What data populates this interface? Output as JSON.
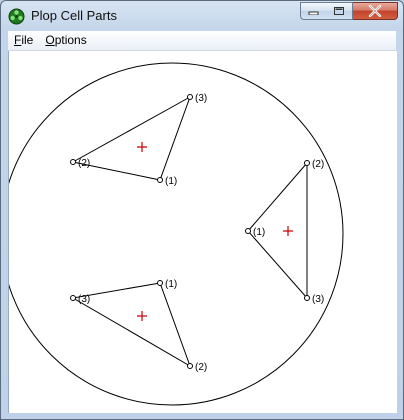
{
  "window": {
    "title": "Plop Cell Parts"
  },
  "menu": {
    "file_label": "File",
    "file_accel": "F",
    "file_rest": "ile",
    "options_label": "Options",
    "options_accel": "O",
    "options_rest": "ptions"
  },
  "colors": {
    "centroid_marker": "#cc0000",
    "outline": "#000000"
  },
  "triangles": [
    {
      "labels": [
        "(3)",
        "(2)",
        "(1)"
      ]
    },
    {
      "labels": [
        "(2)",
        "(1)",
        "(3)"
      ]
    },
    {
      "labels": [
        "(1)",
        "(3)",
        "(2)"
      ]
    }
  ]
}
